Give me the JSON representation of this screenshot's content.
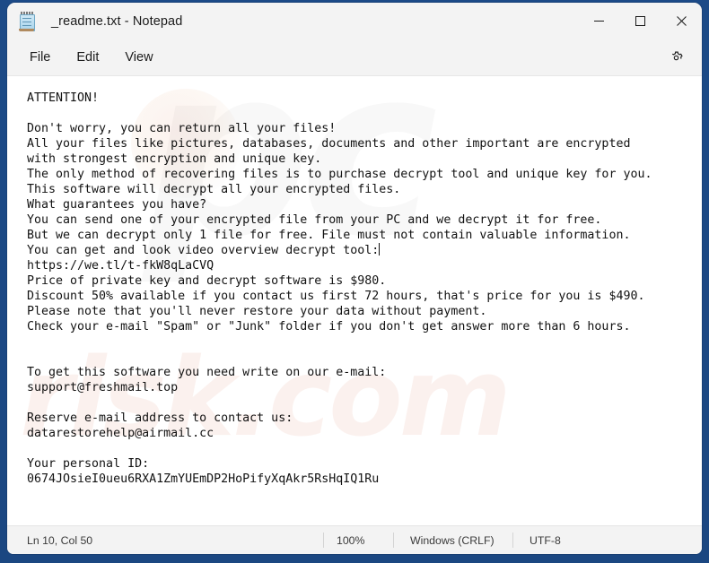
{
  "window": {
    "title": "_readme.txt - Notepad",
    "app_icon": "notepad-icon",
    "controls": {
      "minimize": "minimize-icon",
      "maximize": "maximize-icon",
      "close": "close-icon"
    }
  },
  "menubar": {
    "items": [
      {
        "label": "File"
      },
      {
        "label": "Edit"
      },
      {
        "label": "View"
      }
    ],
    "settings_icon": "gear-icon"
  },
  "editor": {
    "content": "ATTENTION!\n\nDon't worry, you can return all your files!\nAll your files like pictures, databases, documents and other important are encrypted\nwith strongest encryption and unique key.\nThe only method of recovering files is to purchase decrypt tool and unique key for you.\nThis software will decrypt all your encrypted files.\nWhat guarantees you have?\nYou can send one of your encrypted file from your PC and we decrypt it for free.\nBut we can decrypt only 1 file for free. File must not contain valuable information.\nYou can get and look video overview decrypt tool:",
    "content_after_caret": "\nhttps://we.tl/t-fkW8qLaCVQ\nPrice of private key and decrypt software is $980.\nDiscount 50% available if you contact us first 72 hours, that's price for you is $490.\nPlease note that you'll never restore your data without payment.\nCheck your e-mail \"Spam\" or \"Junk\" folder if you don't get answer more than 6 hours.\n\n\nTo get this software you need write on our e-mail:\nsupport@freshmail.top\n\nReserve e-mail address to contact us:\ndatarestorehelp@airmail.cc\n\nYour personal ID:\n0674JOsieI0ueu6RXA1ZmYUEmDP2HoPifyXqAkr5RsHqIQ1Ru",
    "watermark_logo": "pc",
    "watermark_text": "risk.com"
  },
  "statusbar": {
    "position": "Ln 10, Col 50",
    "zoom": "100%",
    "line_ending": "Windows (CRLF)",
    "encoding": "UTF-8"
  },
  "colors": {
    "desktop": "#1c4a87",
    "chrome": "#f3f3f3",
    "editor_bg": "#ffffff",
    "text": "#121212"
  }
}
